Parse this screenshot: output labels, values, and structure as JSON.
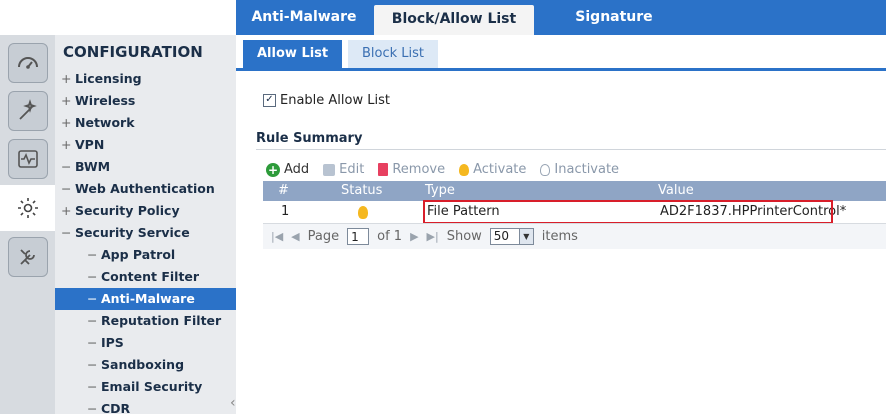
{
  "top_tabs": [
    {
      "label": "Anti-Malware",
      "active": false
    },
    {
      "label": "Block/Allow List",
      "active": true
    },
    {
      "label": "Signature",
      "active": false
    }
  ],
  "sidebar": {
    "icons": [
      "dashboard-icon",
      "wizard-icon",
      "monitor-icon",
      "configuration-gear-icon",
      "maintenance-tools-icon"
    ],
    "title": "CONFIGURATION",
    "items": [
      {
        "sym": "+",
        "label": "Licensing",
        "level": 1
      },
      {
        "sym": "+",
        "label": "Wireless",
        "level": 1
      },
      {
        "sym": "+",
        "label": "Network",
        "level": 1
      },
      {
        "sym": "+",
        "label": "VPN",
        "level": 1
      },
      {
        "sym": "−",
        "label": "BWM",
        "level": 1
      },
      {
        "sym": "−",
        "label": "Web Authentication",
        "level": 1
      },
      {
        "sym": "+",
        "label": "Security Policy",
        "level": 1
      },
      {
        "sym": "−",
        "label": "Security Service",
        "level": 1
      },
      {
        "sym": "−",
        "label": "App Patrol",
        "level": 2
      },
      {
        "sym": "−",
        "label": "Content Filter",
        "level": 2
      },
      {
        "sym": "−",
        "label": "Anti-Malware",
        "level": 2,
        "active": true
      },
      {
        "sym": "−",
        "label": "Reputation Filter",
        "level": 2
      },
      {
        "sym": "−",
        "label": "IPS",
        "level": 2
      },
      {
        "sym": "−",
        "label": "Sandboxing",
        "level": 2
      },
      {
        "sym": "−",
        "label": "Email Security",
        "level": 2
      },
      {
        "sym": "−",
        "label": "CDR",
        "level": 2
      }
    ]
  },
  "sub_tabs": {
    "allow": "Allow List",
    "block": "Block List"
  },
  "enable_allow": {
    "label": "Enable Allow List",
    "checked": true,
    "mark": "✓"
  },
  "rule_summary": "Rule Summary",
  "toolbar": {
    "add": "Add",
    "edit": "Edit",
    "remove": "Remove",
    "activate": "Activate",
    "inactivate": "Inactivate"
  },
  "table": {
    "headers": {
      "num": "#",
      "status": "Status",
      "type": "Type",
      "value": "Value"
    },
    "rows": [
      {
        "num": "1",
        "status": "active",
        "type": "File Pattern",
        "value": "AD2F1837.HPPrinterControl*"
      }
    ]
  },
  "pager": {
    "page_label": "Page",
    "page": "1",
    "of": "of 1",
    "show": "Show",
    "per_page": "50",
    "items": "items"
  },
  "colors": {
    "accent": "#2b72c8",
    "highlight": "#d81e2a",
    "header": "#8fa5c5"
  }
}
